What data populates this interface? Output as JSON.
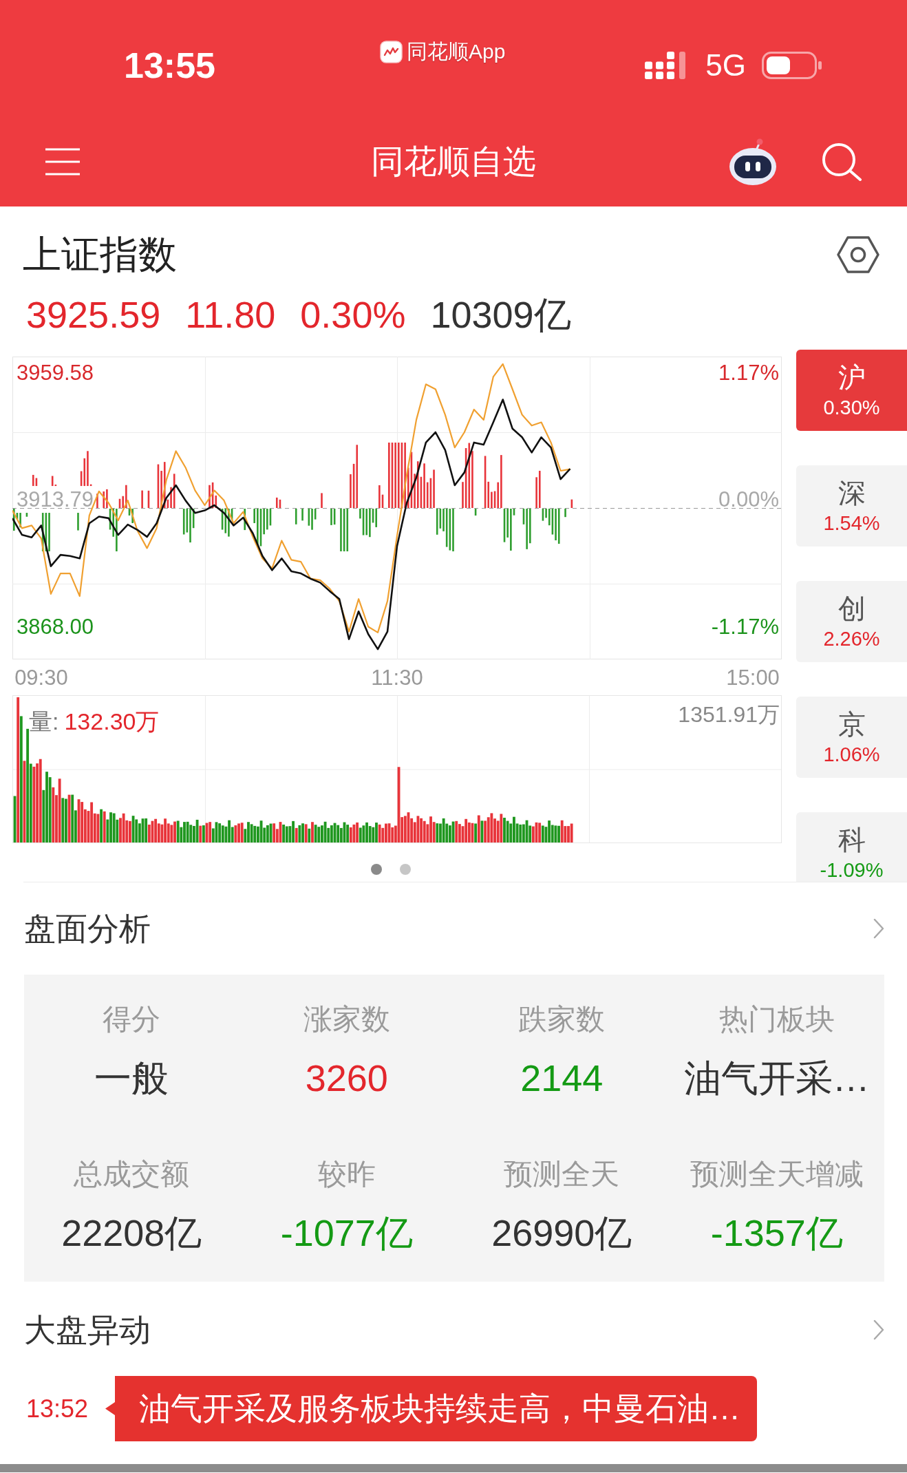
{
  "status_bar": {
    "time": "13:55",
    "app_label": "同花顺App",
    "network": "5G"
  },
  "nav_bar": {
    "title": "同花顺自选"
  },
  "index_header": {
    "title": "上证指数",
    "quotes": [
      {
        "text": "3925.59",
        "color": "#e3262c"
      },
      {
        "text": "11.80",
        "color": "#e3262c"
      },
      {
        "text": "0.30%",
        "color": "#e3262c"
      },
      {
        "text": "10309亿",
        "color": "#333333"
      }
    ]
  },
  "intraday_chart": {
    "percent_labels": [
      "1.17%",
      "0.00%",
      "-1.17%"
    ],
    "chart_data": {
      "type": "line",
      "categories": [
        null,
        null,
        null,
        "09:30",
        null,
        null,
        null,
        null,
        null,
        null,
        null,
        null,
        null,
        null,
        null,
        null,
        null,
        null,
        null,
        null,
        null,
        null,
        null,
        null,
        null,
        null,
        null,
        null,
        null,
        null,
        null,
        null,
        null,
        null,
        null,
        null,
        null,
        null,
        null,
        null,
        "11:30",
        null,
        null,
        null,
        null,
        null,
        null,
        null,
        null,
        null,
        null,
        null,
        null,
        null,
        null,
        null,
        null,
        null,
        null,
        null,
        null,
        null,
        null,
        null,
        null,
        null,
        null,
        null,
        null,
        null,
        null,
        null,
        null,
        null,
        null,
        null,
        null,
        "15:00",
        null,
        null,
        null
      ],
      "ylim": [
        3856.1,
        3965.3
      ],
      "yticks": [
        {
          "value": 3959.58,
          "label": "3959.58"
        },
        {
          "value": 3913.79,
          "label": "3913.79"
        },
        {
          "value": 3868,
          "label": "3868.00"
        }
      ],
      "series": [
        {
          "color": "#111111",
          "values": [
            3907.0,
            3901.0,
            3900.1,
            3904.4,
            3889.7,
            3893.8,
            3893.4,
            3892.5,
            3905.2,
            3907.6,
            3907.0,
            3901.0,
            3904.7,
            3902.8,
            3900.3,
            3905.2,
            3914.3,
            3918.9,
            3913.4,
            3908.9,
            3909.8,
            3911.7,
            3908.9,
            3904.4,
            3907.2,
            3901.6,
            3893.4,
            3888.3,
            3892.5,
            3887.9,
            3887.1,
            3885.2,
            3883.8,
            3880.7,
            3877.9,
            3863.4,
            3873.4,
            3865.2,
            3859.8,
            3866.1,
            3897.0,
            3912.5,
            3921.7,
            3934.3,
            3938.0,
            3931.6,
            3918.9,
            3923.5,
            3934.3,
            3933.5,
            3941.6,
            3949.8,
            3939.3,
            3936.2,
            3930.7,
            3936.2,
            3932.5,
            3921.1,
            3924.8,
            null,
            null,
            null,
            null,
            null,
            null,
            null,
            null,
            null,
            null,
            null,
            null,
            null,
            null,
            null,
            null,
            null,
            null,
            null,
            null,
            null,
            null
          ]
        },
        {
          "color": "#f0a030",
          "values": [
            3909.8,
            3903.4,
            3904.4,
            3899.7,
            3879.7,
            3887.1,
            3887.1,
            3878.9,
            3908.0,
            3916.7,
            3912.5,
            3906.2,
            3913.4,
            3902.5,
            3896.2,
            3903.4,
            3920.7,
            3931.2,
            3925.3,
            3917.0,
            3911.7,
            3917.0,
            3913.4,
            3905.2,
            3909.3,
            3900.3,
            3892.5,
            3888.9,
            3898.9,
            3892.0,
            3891.3,
            3885.2,
            3884.7,
            3881.6,
            3877.1,
            3866.1,
            3877.9,
            3867.9,
            3865.8,
            3877.1,
            3900.7,
            3922.5,
            3942.5,
            3955.3,
            3953.5,
            3944.3,
            3932.5,
            3938.0,
            3946.2,
            3942.5,
            3958.0,
            3962.6,
            3953.5,
            3944.3,
            3940.4,
            3941.6,
            3934.3,
            3924.1,
            3924.7,
            null,
            null,
            null,
            null,
            null,
            null,
            null,
            null,
            null,
            null,
            null,
            null,
            null,
            null,
            null,
            null,
            null,
            null,
            null,
            null,
            null,
            null
          ]
        }
      ]
    }
  },
  "volume_chart": {
    "label": "量:",
    "value": "132.30万",
    "max_label": "1351.91万"
  },
  "pager": [
    {
      "selected": true
    },
    {
      "selected": false
    }
  ],
  "side_tabs": [
    {
      "label": "沪",
      "value": "0.30%",
      "color": "#e63a3c",
      "selected": true
    },
    {
      "label": "深",
      "value": "1.54%",
      "color": "#e3262c",
      "selected": false
    },
    {
      "label": "创",
      "value": "2.26%",
      "color": "#e3262c",
      "selected": false
    },
    {
      "label": "京",
      "value": "1.06%",
      "color": "#e3262c",
      "selected": false
    },
    {
      "label": "科",
      "value": "-1.09%",
      "color": "#149a14",
      "selected": false
    }
  ],
  "analysis": {
    "title": "盘面分析",
    "cells": [
      {
        "label": "得分",
        "value": "一般",
        "color": "#333333"
      },
      {
        "label": "涨家数",
        "value": "3260",
        "color": "#e3262c"
      },
      {
        "label": "跌家数",
        "value": "2144",
        "color": "#149a14"
      },
      {
        "label": "热门板块",
        "value": "油气开采…",
        "color": "#333333"
      },
      {
        "label": "总成交额",
        "value": "22208亿",
        "color": "#333333"
      },
      {
        "label": "较昨",
        "value": "-1077亿",
        "color": "#149a14"
      },
      {
        "label": "预测全天",
        "value": "26990亿",
        "color": "#333333"
      },
      {
        "label": "预测全天增减",
        "value": "-1357亿",
        "color": "#149a14"
      }
    ]
  },
  "market_events": {
    "title": "大盘异动",
    "items": [
      {
        "time": "13:52",
        "text": "油气开采及服务板块持续走高，中曼石油…"
      }
    ]
  }
}
